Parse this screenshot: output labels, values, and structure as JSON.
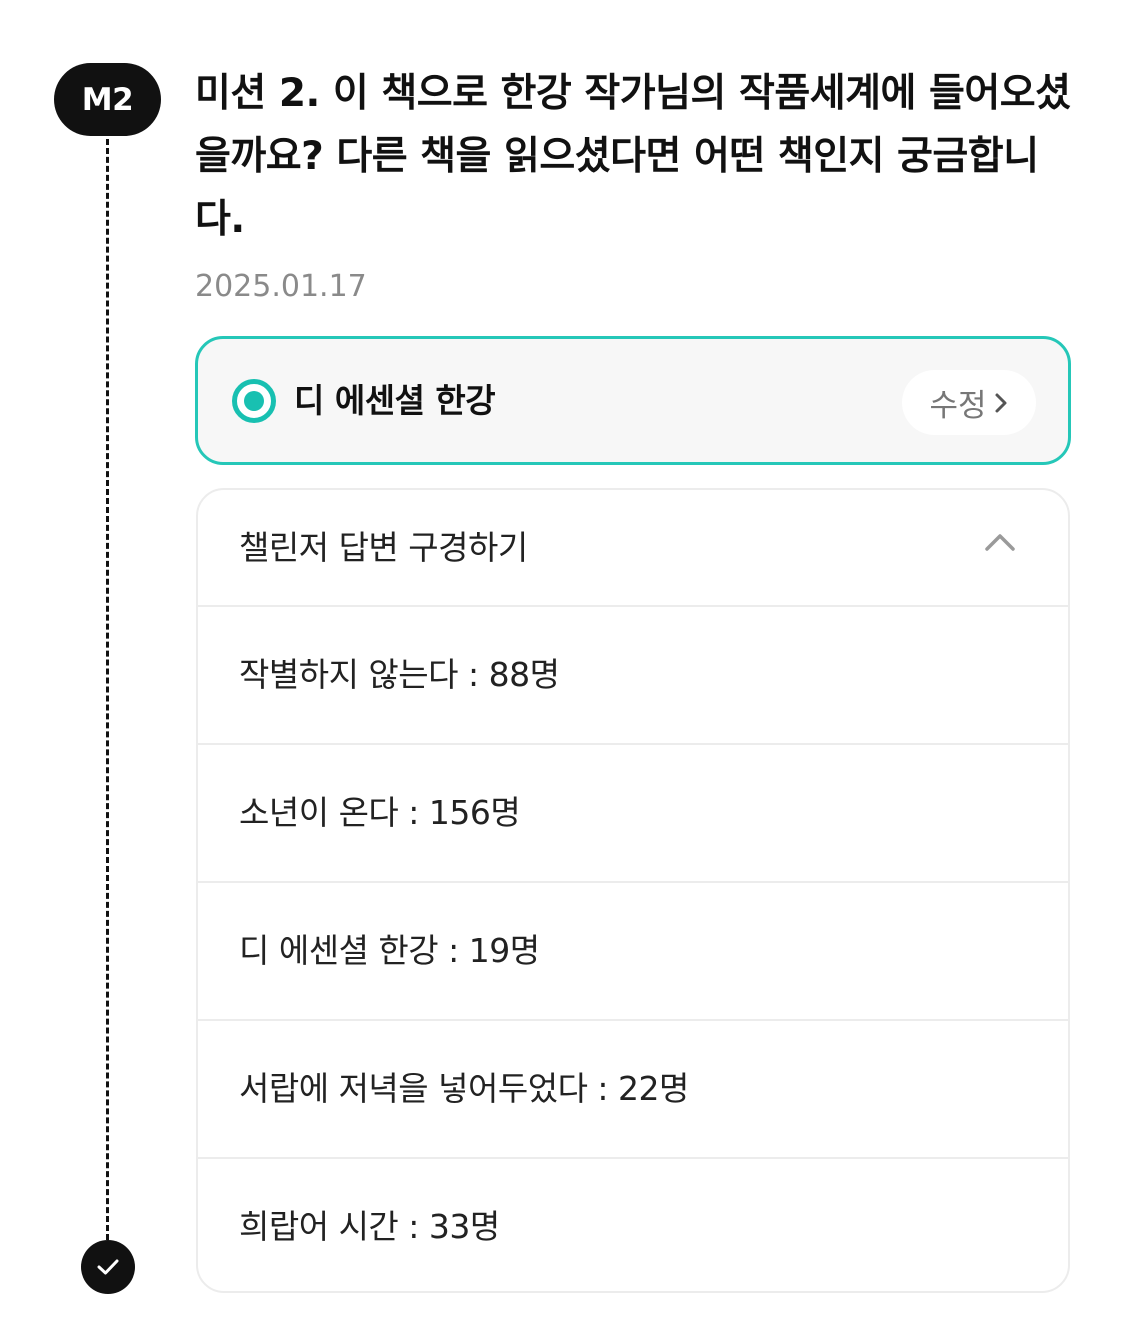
{
  "mission": {
    "badge": "M2",
    "title": "미션 2. 이 책으로 한강 작가님의 작품세계에 들어오셨을까요? 다른 책을 읽으셨다면 어떤 책인지 궁금합니다.",
    "date": "2025.01.17",
    "status_icon": "check-icon"
  },
  "selected_answer": {
    "label": "디 에센셜 한강",
    "edit_label": "수정",
    "accent_color": "#18c0b1"
  },
  "answers": {
    "header_label": "챌린저 답변 구경하기",
    "expanded": true,
    "items": [
      {
        "text": "작별하지 않는다 : 88명"
      },
      {
        "text": "소년이 온다 : 156명"
      },
      {
        "text": "디 에센셜 한강 : 19명"
      },
      {
        "text": "서랍에 저녁을 넣어두었다 : 22명"
      },
      {
        "text": "희랍어 시간 : 33명"
      }
    ]
  }
}
